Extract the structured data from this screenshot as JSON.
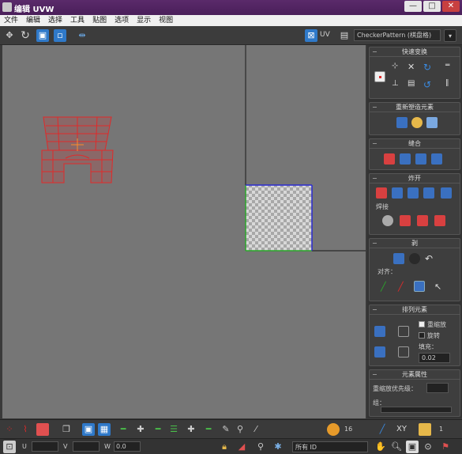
{
  "window": {
    "title": "编辑 UVW",
    "minimize": "—",
    "maximize": "□",
    "close": "✕"
  },
  "menu": [
    "文件",
    "编辑",
    "选择",
    "工具",
    "贴图",
    "选项",
    "显示",
    "视图"
  ],
  "toolbar": {
    "uv_label": "UV",
    "texture_select": "CheckerPattern (棋盘格)"
  },
  "panels": {
    "quick_transform": "快速变换",
    "reshape": "重新塑造元素",
    "stitch": "缝合",
    "explode": "炸开",
    "weld_label": "焊接",
    "peel": "剥",
    "align_label": "对齐：",
    "arrange": "排列元素",
    "rescale": "重缩放",
    "rotate": "旋转",
    "padding": "填充：",
    "padding_value": "0.02",
    "element_props": "元素属性",
    "group_label": "重缩放优先级：",
    "group_sub": "组："
  },
  "bottom": {
    "u_label": "U",
    "v_label": "V",
    "w_label": "W",
    "all_ids": "所有 ID",
    "xy_label": "XY",
    "value_0": "0.0",
    "spin_1": "16",
    "spin_2": "1",
    "spin_3": "1",
    "zoom_label": "0"
  },
  "colors": {
    "accent": "#2f79c9",
    "mesh": "#e02a2a",
    "border_green": "#2aa72a",
    "border_blue": "#2a2ad0"
  }
}
